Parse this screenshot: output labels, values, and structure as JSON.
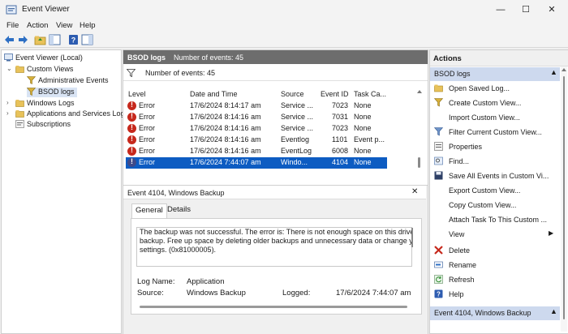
{
  "window": {
    "title": "Event Viewer",
    "min": "—",
    "max": "☐",
    "close": "✕"
  },
  "menu": [
    "File",
    "Action",
    "View",
    "Help"
  ],
  "tree": {
    "root": "Event Viewer (Local)",
    "custom_views": "Custom Views",
    "admin_events": "Administrative Events",
    "bsod_logs": "BSOD logs",
    "windows_logs": "Windows Logs",
    "app_services": "Applications and Services Logs",
    "subscriptions": "Subscriptions"
  },
  "log_header": {
    "name": "BSOD logs",
    "count_label": "Number of events: 45"
  },
  "filter_label": "Number of events: 45",
  "columns": [
    "Level",
    "Date and Time",
    "Source",
    "Event ID",
    "Task Ca..."
  ],
  "rows": [
    {
      "level": "Error",
      "date": "17/6/2024 8:14:17 am",
      "source": "Service ...",
      "id": "7023",
      "task": "None"
    },
    {
      "level": "Error",
      "date": "17/6/2024 8:14:16 am",
      "source": "Service ...",
      "id": "7031",
      "task": "None"
    },
    {
      "level": "Error",
      "date": "17/6/2024 8:14:16 am",
      "source": "Service ...",
      "id": "7023",
      "task": "None"
    },
    {
      "level": "Error",
      "date": "17/6/2024 8:14:16 am",
      "source": "Eventlog",
      "id": "1101",
      "task": "Event p..."
    },
    {
      "level": "Error",
      "date": "17/6/2024 8:14:16 am",
      "source": "EventLog",
      "id": "6008",
      "task": "None"
    },
    {
      "level": "Error",
      "date": "17/6/2024 7:44:07 am",
      "source": "Windo...",
      "id": "4104",
      "task": "None"
    }
  ],
  "detail": {
    "title": "Event 4104, Windows Backup",
    "close": "✕",
    "tabs": [
      "General",
      "Details"
    ],
    "message_lines": [
      "The backup was not successful. The error is: There is not enough space on this drive",
      "backup. Free up space by deleting older backups and unnecessary data or change y",
      "settings. (0x81000005)."
    ],
    "log_name_label": "Log Name:",
    "log_name_value": "Application",
    "source_label": "Source:",
    "source_value": "Windows Backup",
    "logged_label": "Logged:",
    "logged_value": "17/6/2024 7:44:07 am"
  },
  "actions": {
    "title": "Actions",
    "section1": "BSOD logs",
    "items": [
      "Open Saved Log...",
      "Create Custom View...",
      "Import Custom View...",
      "Filter Current Custom View...",
      "Properties",
      "Find...",
      "Save All Events in Custom Vi...",
      "Export Custom View...",
      "Copy Custom View...",
      "Attach Task To This Custom ...",
      "View",
      "Delete",
      "Rename",
      "Refresh",
      "Help"
    ],
    "section2": "Event 4104, Windows Backup"
  },
  "colors": {
    "selection": "#0d5cc2",
    "section_band": "#cdd9ee",
    "header_gray": "#6d6d6d",
    "error_red": "#c6281c"
  }
}
